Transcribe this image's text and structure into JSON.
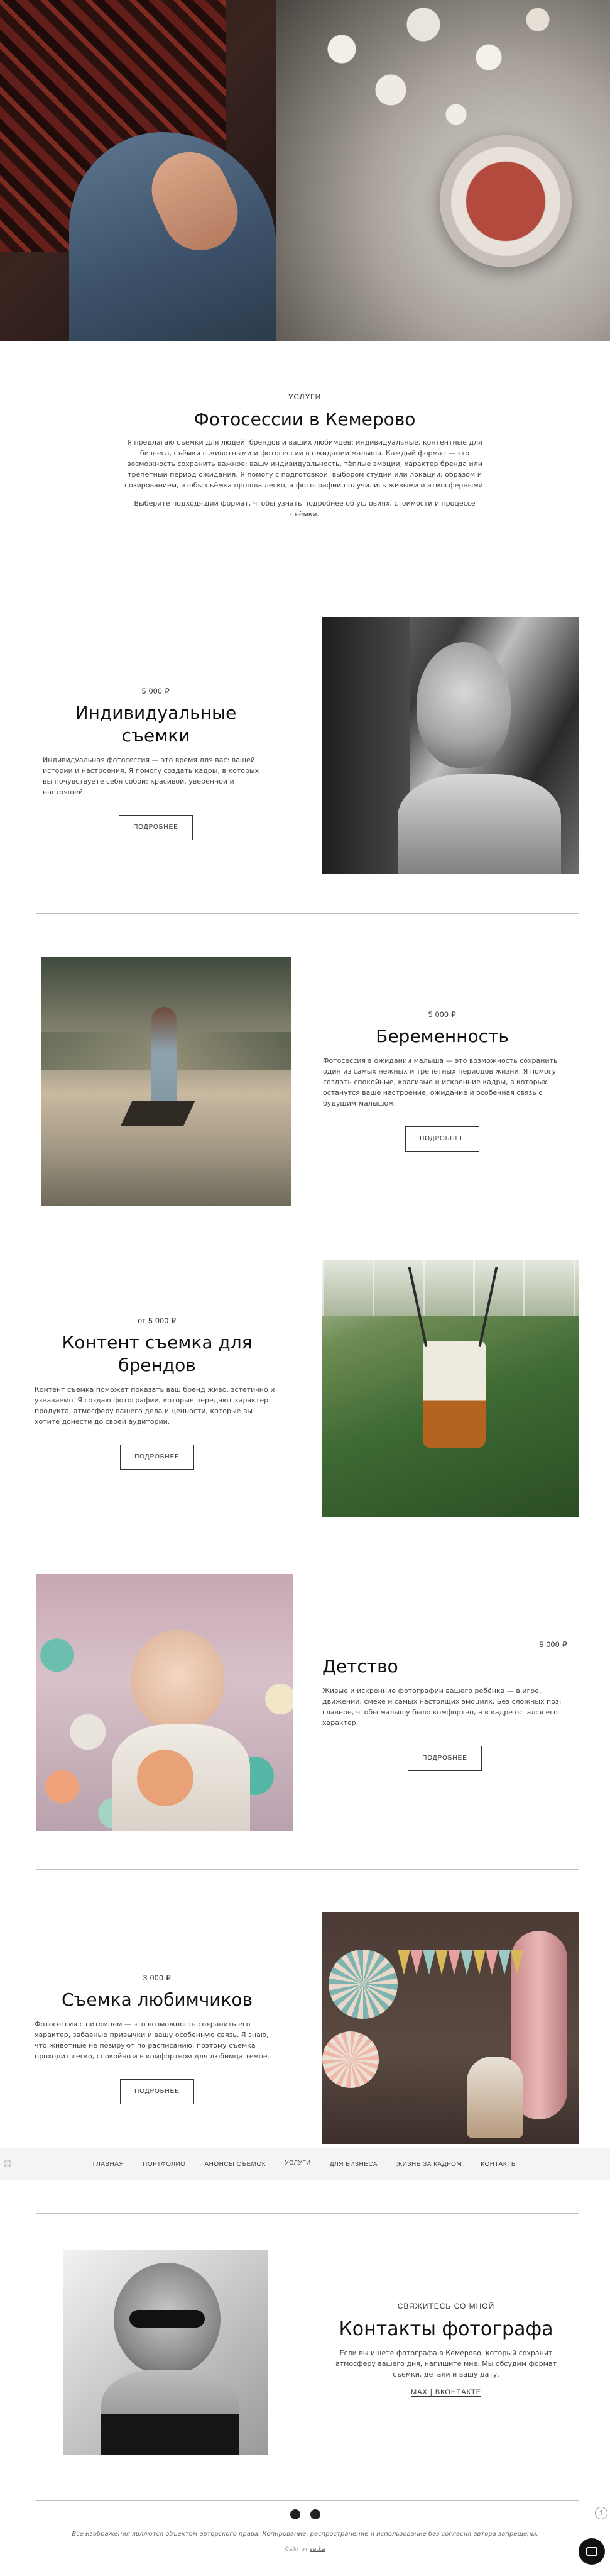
{
  "hero": {
    "image_name": "hero-photo"
  },
  "intro": {
    "eyebrow": "Услуги",
    "title": "Фотосессии в Кемерово",
    "paragraph1": "Я предлагаю съёмки для людей, брендов и ваших любимцев: индивидуальные, контентные для бизнеса, съёмки с животными и фотосессии в ожидании малыша. Каждый формат — это возможность сохранить важное: вашу индивидуальность, тёплые эмоции, характер бренда или трепетный период ожидания. Я помогу с подготовкой, выбором студии или локации, образом и позированием, чтобы съёмка прошла легко, а фотографии получились живыми и атмосферными.",
    "paragraph2": "Выберите подходящий формат, чтобы узнать подробнее об условиях, стоимости и процессе съёмки."
  },
  "services": [
    {
      "price": "5 000 ₽",
      "title": "Индивидуальные съемки",
      "text": "Индивидуальная фотосессия — это время для вас: вашей истории и настроения. Я помогу создать кадры, в которых вы почувствуете себя собой: красивой, уверенной и настоящей.",
      "button": "Подробнее"
    },
    {
      "price": "5 000 ₽",
      "title": "Беременность",
      "text": "Фотосессия в ожидании малыша — это возможность сохранить один из самых нежных и трепетных периодов жизни. Я помогу создать спокойные, красивые и искренние кадры, в которых останутся ваше настроение, ожидание и особенная связь с будущим малышом.",
      "button": "Подробнее"
    },
    {
      "price": "от 5 000 ₽",
      "title": "Контент съемка для брендов",
      "text": "Контент съёмка поможет показать ваш бренд живо, эстетично и узнаваемо. Я создаю фотографии, которые передают характер продукта, атмосферу вашего дела и ценности, которые вы хотите донести до своей аудитории.",
      "button": "Подробнее"
    },
    {
      "price": "5 000 ₽",
      "title": "Детство",
      "text": "Живые и искренние фотографии вашего ребёнка — в игре, движении, смехе и самых настоящих эмоциях. Без сложных поз: главное, чтобы малышу было комфортно, а в кадре остался его характер.",
      "button": "Подробнее"
    },
    {
      "price": "3 000 ₽",
      "title": "Съемка любимчиков",
      "text": "Фотосессия с питомцем — это возможность сохранить его характер, забавные привычки и вашу особенную связь. Я знаю, что животные не позируют по расписанию, поэтому съёмка проходит легко, спокойно и в комфортном для любимца темпе.",
      "button": "Подробнее"
    }
  ],
  "nav": {
    "items": [
      "Главная",
      "Портфолио",
      "Анонсы съемок",
      "Услуги",
      "Для бизнеса",
      "Жизнь за кадром",
      "Контакты"
    ],
    "active_index": 3
  },
  "contact": {
    "eyebrow": "Свяжитесь со мной",
    "title": "Контакты фотографа",
    "text": "Если вы ищете фотографа в Кемерово, который сохранит атмосферу вашего дня, напишите мне. Мы обсудим формат съёмки, детали и вашу дату.",
    "link": "Мах | ВКонтакте"
  },
  "footer": {
    "copyright": "Все изображения являются объектом авторского права. Копирование, распространение и использование без согласия автора запрещены.",
    "made_prefix": "Сайт от",
    "made_link": "setka"
  },
  "colors": {
    "text": "#222222",
    "divider": "#bfbfbf",
    "nav_bg": "#f4f4f4",
    "accent": "#111111"
  }
}
